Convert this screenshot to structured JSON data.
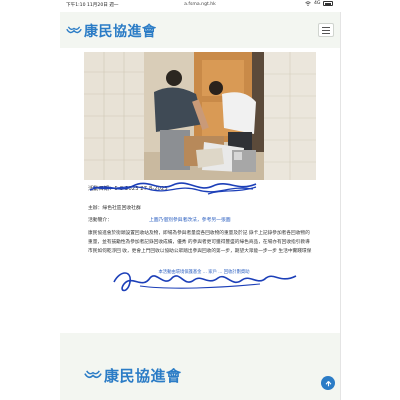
{
  "status_bar": {
    "time": "下午1:10  11月20日 週一",
    "url": "a.fsma.ngt.hk",
    "signal": "4G"
  },
  "header": {
    "logo_text": "康民協進會",
    "menu_icon": "hamburger-icon"
  },
  "article": {
    "date_line": "活動日期：5-8-2023 27-8-2023",
    "organizer": "主辦：綠色社區回收社群",
    "intro_label": "活動簡介：",
    "link_text": "上圖乃個別參與者改法，參考另一張圖",
    "description": "康民協進會於街頭設置回收站及物，即場為參與者量度各回收物的重量及於記 錄卡上記錄參加者各回收物的重量，並有鼓勵性為參加者記錄回收成績，優秀 的參與者更可獲得豐盛的綠色商品，在場亦有回收指引教導市民如何乾淨回 收，更會上門回收以協助公眾踏出參與回收的第一步，期望大眾能一步一步 生活中實踐環保",
    "footer_note": "本活動由環境保護基金 ... 家戶 ... 回收計劃資助"
  },
  "footer": {
    "logo_text": "康民協進會",
    "back_to_top_icon": "arrow-up-icon"
  },
  "colors": {
    "brand_blue": "#2b7cc6",
    "header_bg": "#f3f6f1",
    "scribble": "#1c3fb8"
  }
}
